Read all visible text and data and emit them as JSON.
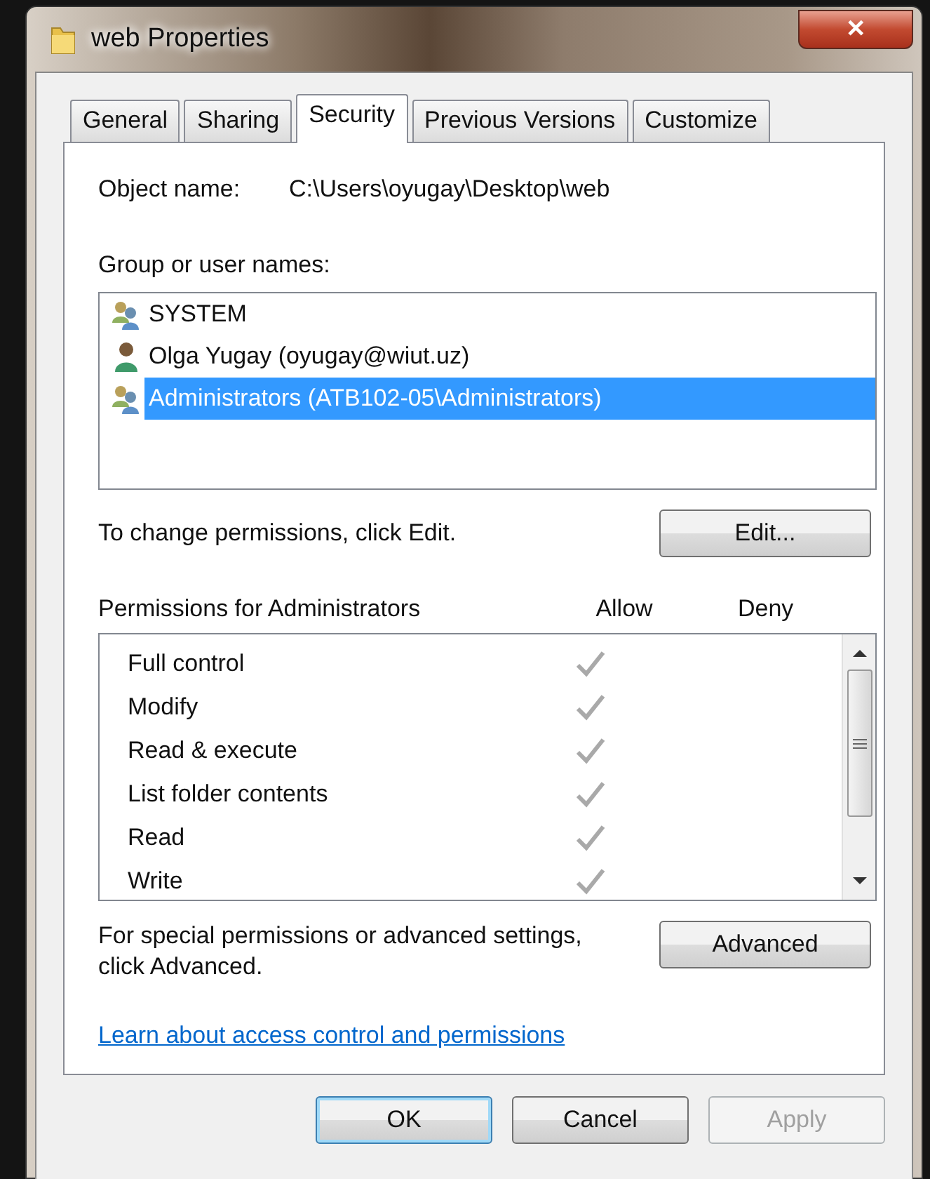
{
  "window": {
    "title": "web Properties",
    "close": "✕"
  },
  "tabs": [
    {
      "label": "General",
      "selected": false
    },
    {
      "label": "Sharing",
      "selected": false
    },
    {
      "label": "Security",
      "selected": true
    },
    {
      "label": "Previous Versions",
      "selected": false
    },
    {
      "label": "Customize",
      "selected": false
    }
  ],
  "object_name": {
    "label": "Object name:",
    "value": "C:\\Users\\oyugay\\Desktop\\web"
  },
  "group_label": "Group or user names:",
  "users": [
    {
      "name": "SYSTEM",
      "kind": "group",
      "selected": false
    },
    {
      "name": "Olga Yugay (oyugay@wiut.uz)",
      "kind": "user",
      "selected": false
    },
    {
      "name": "Administrators (ATB102-05\\Administrators)",
      "kind": "group",
      "selected": true
    }
  ],
  "edit_hint": "To change permissions, click Edit.",
  "edit_button": "Edit...",
  "permissions": {
    "title": "Permissions for Administrators",
    "allow_label": "Allow",
    "deny_label": "Deny",
    "items": [
      {
        "name": "Full control",
        "allow": true,
        "deny": false
      },
      {
        "name": "Modify",
        "allow": true,
        "deny": false
      },
      {
        "name": "Read & execute",
        "allow": true,
        "deny": false
      },
      {
        "name": "List folder contents",
        "allow": true,
        "deny": false
      },
      {
        "name": "Read",
        "allow": true,
        "deny": false
      },
      {
        "name": "Write",
        "allow": true,
        "deny": false
      }
    ]
  },
  "advanced_hint": "For special permissions or advanced settings, click Advanced.",
  "advanced_button": "Advanced",
  "link": "Learn about access control and permissions",
  "buttons": [
    {
      "label": "OK",
      "default": true,
      "disabled": false
    },
    {
      "label": "Cancel",
      "default": false,
      "disabled": false
    },
    {
      "label": "Apply",
      "default": false,
      "disabled": true
    }
  ]
}
